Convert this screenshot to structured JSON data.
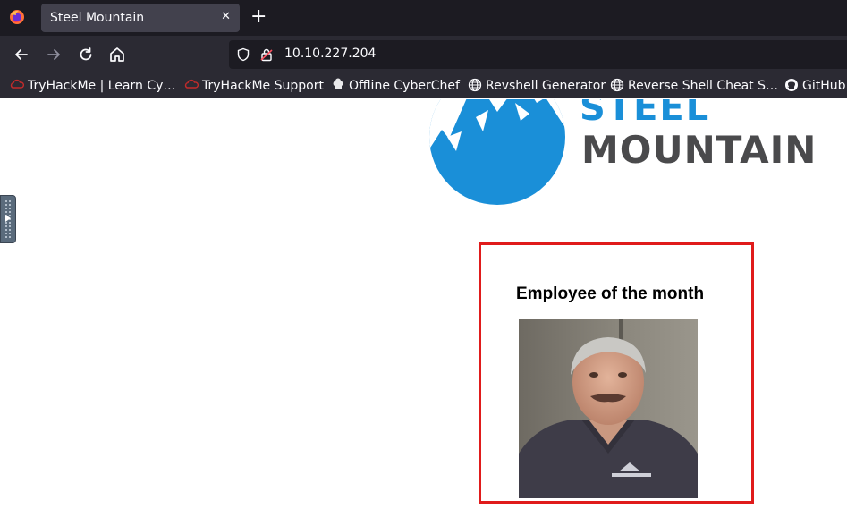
{
  "browser": {
    "tab": {
      "title": "Steel Mountain",
      "close_glyph": "✕"
    },
    "new_tab_glyph": "+",
    "url": "10.10.227.204",
    "bookmarks": [
      {
        "label": "TryHackMe | Learn Cy…",
        "icon": "tryhackme-icon"
      },
      {
        "label": "TryHackMe Support",
        "icon": "tryhackme-icon"
      },
      {
        "label": "Offline CyberChef",
        "icon": "chef-hat-icon"
      },
      {
        "label": "Revshell Generator",
        "icon": "globe-icon"
      },
      {
        "label": "Reverse Shell Cheat S…",
        "icon": "globe-icon"
      },
      {
        "label": "GitHub",
        "icon": "github-icon"
      }
    ]
  },
  "page": {
    "logo": {
      "line1": "STEEL",
      "line2": "MOUNTAIN"
    },
    "employee_of_month": {
      "heading": "Employee of the month"
    }
  },
  "colors": {
    "logo_blue": "#1a8fd8",
    "logo_gray": "#4a4a4c",
    "box_border": "#e01b1b"
  }
}
